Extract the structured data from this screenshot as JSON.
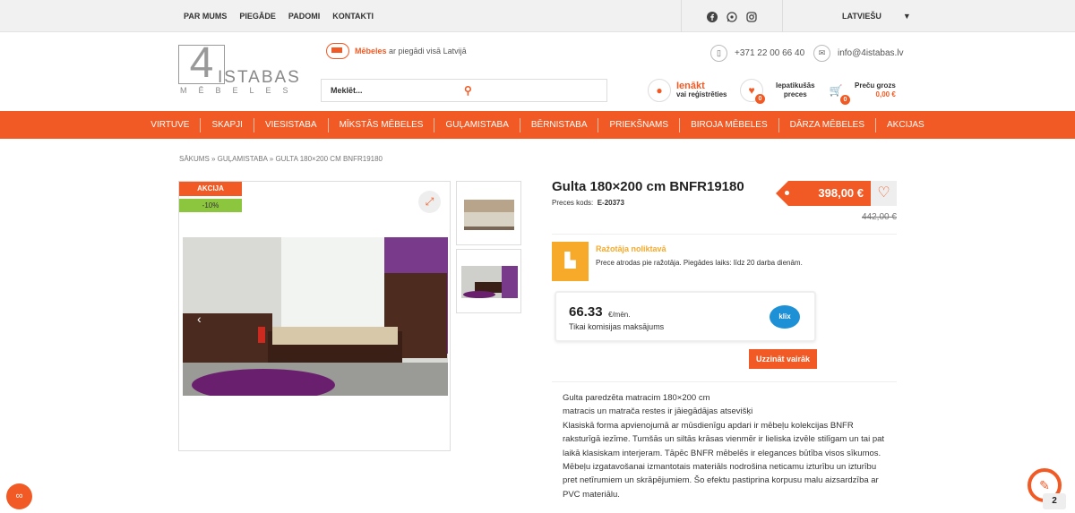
{
  "topbar": {
    "links": [
      "PAR MUMS",
      "PIEGĀDE",
      "PADOMI",
      "KONTAKTI"
    ],
    "language": "LATVIEŠU"
  },
  "header": {
    "logo_number": "4",
    "logo_word": "ISTABAS",
    "logo_sub": "MĒBELES",
    "delivery_bold": "Mēbeles",
    "delivery_rest": " ar piegādi visā Latvijā",
    "phone": "+371 22 00 66 40",
    "email": "info@4istabas.lv",
    "search_placeholder": "Meklēt...",
    "login_title": "Ienākt",
    "login_sub": "vai reģistrēties",
    "fav_title": "Iepatikušās",
    "fav_sub": "preces",
    "fav_count": "0",
    "cart_title": "Preču grozs",
    "cart_sub": "0,00 €",
    "cart_count": "0"
  },
  "mainnav": [
    "VIRTUVE",
    "SKAPJI",
    "VIESISTABA",
    "MĪKSTĀS MĒBELES",
    "GUĻAMISTABA",
    "BĒRNISTABA",
    "PRIEKŠNAMS",
    "BIROJA MĒBELES",
    "DĀRZA MĒBELES",
    "AKCIJAS"
  ],
  "breadcrumb": "SĀKUMS » GUĻAMISTABA » GULTA 180×200 CM BNFR19180",
  "product": {
    "badge_sale": "AKCIJA",
    "badge_discount": "-10%",
    "title": "Gulta 180×200 cm BNFR19180",
    "code_label": "Preces kods:",
    "code_value": "E-20373",
    "price": "398,00 €",
    "old_price": "442,00 €",
    "stock_title": "Ražotāja noliktavā",
    "stock_text": "Prece atrodas pie ražotāja. Piegādes laiks: līdz 20 darba dienām.",
    "klix_amount": "66.33",
    "klix_unit": "€/mēn.",
    "klix_note": "Tikai komisijas maksājums",
    "klix_logo": "klix",
    "more_button": "Uzzināt vairāk",
    "description": [
      "Gulta paredzēta matracim 180×200 cm",
      "matracis un matrača restes ir jāiegādājas atsevišķi",
      "Klasiskā forma apvienojumā ar mūsdienīgu apdari ir mēbeļu kolekcijas BNFR raksturīgā iezīme. Tumšās un siltās krāsas vienmēr ir lieliska izvēle stilīgam un tai pat laikā klasiskam interjeram. Tāpēc BNFR mēbelēs ir elegances būtība visos sīkumos.",
      "Mēbeļu izgatavošanai izmantotais materiāls nodrošina neticamu izturību un izturību pret netīrumiem un skrāpējumiem. Šo efektu pastiprina korpusu malu aizsardzība ar PVC materiālu."
    ]
  },
  "widgets": {
    "notification_count": "2"
  },
  "colors": {
    "accent": "#f15a24",
    "stock": "#f7a929",
    "green": "#8cc63f",
    "klix": "#1e90d6"
  }
}
